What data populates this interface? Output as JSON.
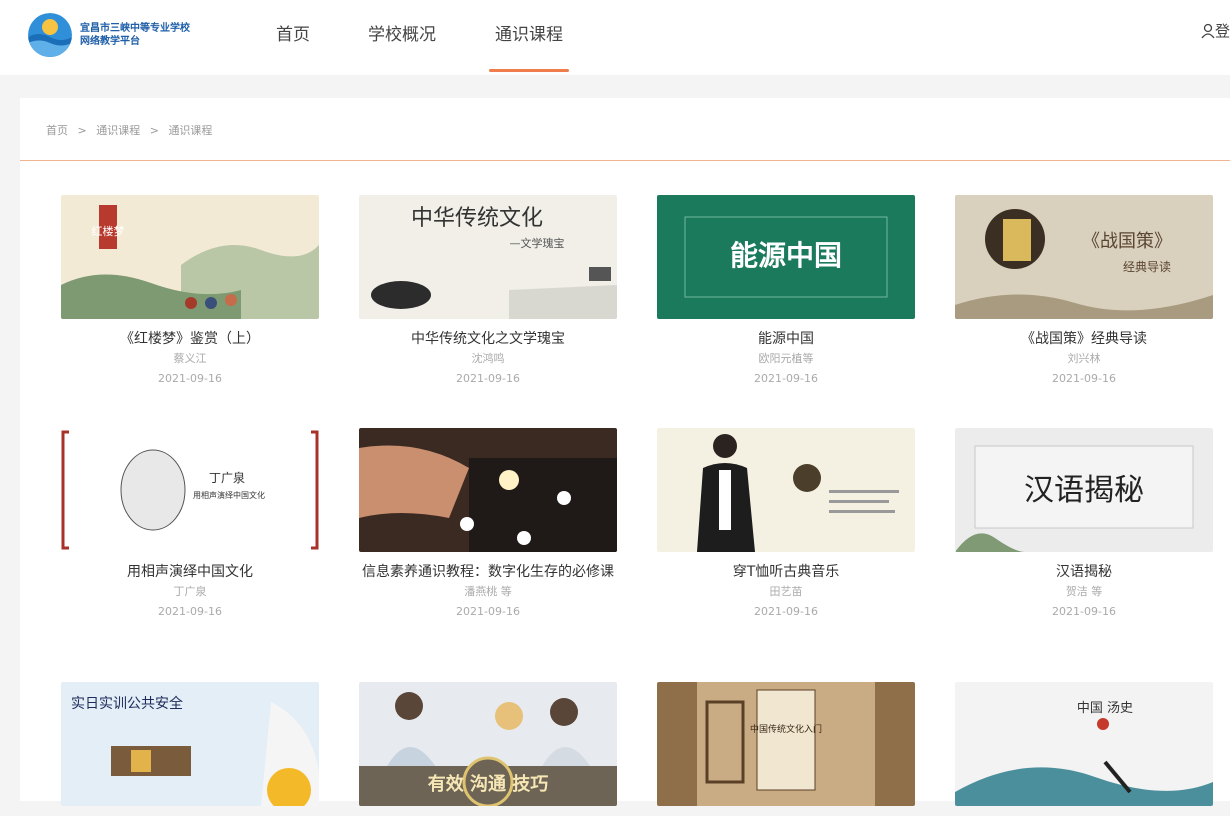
{
  "site": {
    "logo_line1": "宜昌市三峡中等专业学校",
    "logo_line2": "网络教学平台"
  },
  "nav": [
    {
      "label": "首页"
    },
    {
      "label": "学校概况"
    },
    {
      "label": "通识课程"
    }
  ],
  "nav_active_index": 2,
  "login_label": "登",
  "breadcrumb": [
    "首页",
    ">",
    "通识课程",
    ">",
    "通识课程"
  ],
  "courses": [
    {
      "title": "《红楼梦》鉴赏（上）",
      "author": "蔡义江",
      "date": "2021-09-16",
      "thumb_text": "红楼梦"
    },
    {
      "title": "中华传统文化之文学瑰宝",
      "author": "沈鸿鸣",
      "date": "2021-09-16",
      "thumb_text": "中华传统文化",
      "thumb_sub": "—文学瑰宝"
    },
    {
      "title": "能源中国",
      "author": "欧阳元植等",
      "date": "2021-09-16",
      "thumb_text": "能源中国"
    },
    {
      "title": "《战国策》经典导读",
      "author": "刘兴林",
      "date": "2021-09-16",
      "thumb_text": "《战国策》",
      "thumb_sub": "经典导读"
    },
    {
      "title": "用相声演绎中国文化",
      "author": "丁广泉",
      "date": "2021-09-16",
      "thumb_text": "丁广泉",
      "thumb_sub": "用相声演绎中国文化"
    },
    {
      "title": "信息素养通识教程：数字化生存的必修课",
      "author": "潘燕桃 等",
      "date": "2021-09-16"
    },
    {
      "title": "穿T恤听古典音乐",
      "author": "田艺苗",
      "date": "2021-09-16"
    },
    {
      "title": "汉语揭秘",
      "author": "贺洁 等",
      "date": "2021-09-16",
      "thumb_text": "汉语揭秘"
    },
    {
      "title": "",
      "author": "",
      "date": "",
      "thumb_text": "实日实训公共安全"
    },
    {
      "title": "",
      "author": "",
      "date": "",
      "thumb_text": "有效 沟通 技巧"
    },
    {
      "title": "",
      "author": "",
      "date": "",
      "thumb_text": "中国传统文化入门"
    },
    {
      "title": "",
      "author": "",
      "date": "",
      "thumb_text": "中国 汤史"
    }
  ]
}
